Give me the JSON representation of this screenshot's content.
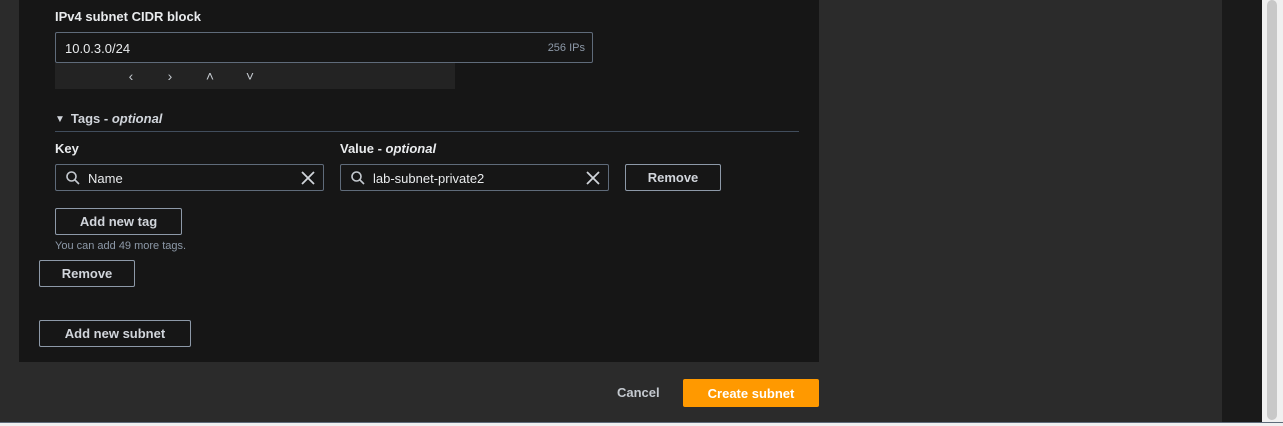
{
  "cidr": {
    "label": "IPv4 subnet CIDR block",
    "value": "10.0.3.0/24",
    "ip_count": "256 IPs",
    "stepper": [
      "‹",
      "›",
      "˄",
      "˅"
    ]
  },
  "tags": {
    "header_text": "Tags -",
    "header_optional": "optional",
    "key_label": "Key",
    "value_label_text": "Value -",
    "value_label_optional": "optional",
    "key_value": "Name",
    "value_value": "lab-subnet-private2",
    "remove_tag_label": "Remove",
    "add_tag_label": "Add new tag",
    "hint": "You can add 49 more tags."
  },
  "subnet": {
    "remove_label": "Remove",
    "add_subnet_label": "Add new subnet"
  },
  "footer": {
    "cancel_label": "Cancel",
    "create_label": "Create subnet"
  },
  "colors": {
    "primary": "#ff9900",
    "panel": "#161616",
    "border": "#5f6b7a"
  },
  "icons": [
    "search-icon",
    "clear-icon",
    "caret-down-icon",
    "chevron-left-icon",
    "chevron-right-icon",
    "chevron-up-icon",
    "chevron-down-icon"
  ]
}
